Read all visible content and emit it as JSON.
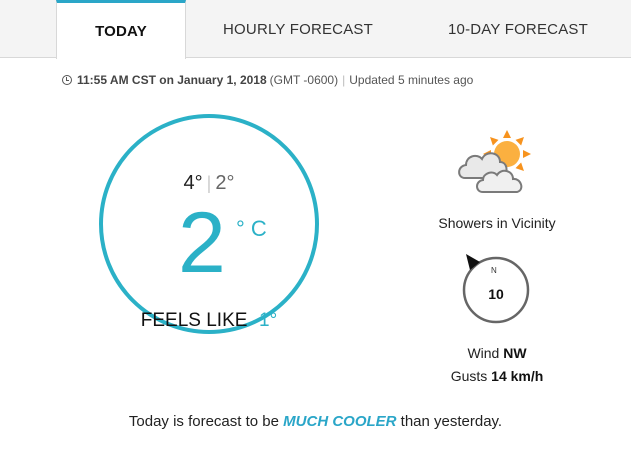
{
  "tabs": [
    {
      "label": "TODAY",
      "active": true
    },
    {
      "label": "HOURLY FORECAST",
      "active": false
    },
    {
      "label": "10-DAY FORECAST",
      "active": false
    }
  ],
  "timestamp": {
    "time_date": "11:55 AM CST on January 1, 2018",
    "offset": "(GMT -0600)",
    "separator": "|",
    "updated": "Updated 5 minutes ago"
  },
  "current": {
    "high": "4°",
    "low": "2°",
    "divider": "|",
    "temperature": "2",
    "unit": "° C",
    "feels_like_label": "FEELS LIKE",
    "feels_like_value": "-1°"
  },
  "condition": {
    "icon": "partly-cloudy-showers-icon",
    "label": "Showers in Vicinity"
  },
  "wind": {
    "compass_label": "N",
    "speed": "10",
    "label": "Wind",
    "direction": "NW",
    "gusts_label": "Gusts",
    "gusts_value": "14 km/h"
  },
  "summary": {
    "prefix": "Today is forecast to be",
    "emphasis": "MUCH COOLER",
    "suffix": "than yesterday."
  },
  "colors": {
    "accent": "#2bb1c7",
    "sun": "#f7931e",
    "cloud": "#e6e6e6"
  }
}
